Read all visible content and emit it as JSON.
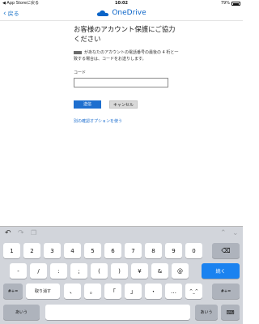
{
  "status_bar": {
    "back_to_app": "◀ App Storeに戻る",
    "time": "10:02",
    "battery": "79%"
  },
  "nav": {
    "back_label": "戻る",
    "brand": "OneDrive",
    "brand_color": "#0a64c8"
  },
  "main": {
    "title": "お客様のアカウント保護にご協力ください",
    "description": "があなたのアカウントの電話番号の最後の 4 桁と一致する場合は、コードをお送りします。",
    "code_label": "コード",
    "code_value": "",
    "send_button": "送信",
    "cancel_button": "キャンセル",
    "other_option_link": "別の確認オプションを使う"
  },
  "keyboard": {
    "toolbar": {
      "undo_icon": "undo-icon",
      "redo_icon": "redo-icon",
      "paste_icon": "paste-icon",
      "up_icon": "chevron-up-icon",
      "down_icon": "chevron-down-icon"
    },
    "row1": [
      "1",
      "2",
      "3",
      "4",
      "5",
      "6",
      "7",
      "8",
      "9",
      "0"
    ],
    "delete_icon": "delete-icon",
    "row2": [
      "-",
      "/",
      ":",
      ";",
      "(",
      ")",
      "¥",
      "&",
      "@"
    ],
    "next_key": "続く",
    "row3_left": "#+=",
    "undo_key": "取り消す",
    "row3": [
      "、",
      "。",
      "「",
      "」",
      "・",
      "…"
    ],
    "kana_key": "^_^",
    "row3_right": "#+=",
    "globe_icon": "globe-icon",
    "abc_left": "あいう",
    "abc_right": "あいう",
    "dismiss_icon": "keyboard-dismiss-icon",
    "accent": "#1a82f0"
  }
}
